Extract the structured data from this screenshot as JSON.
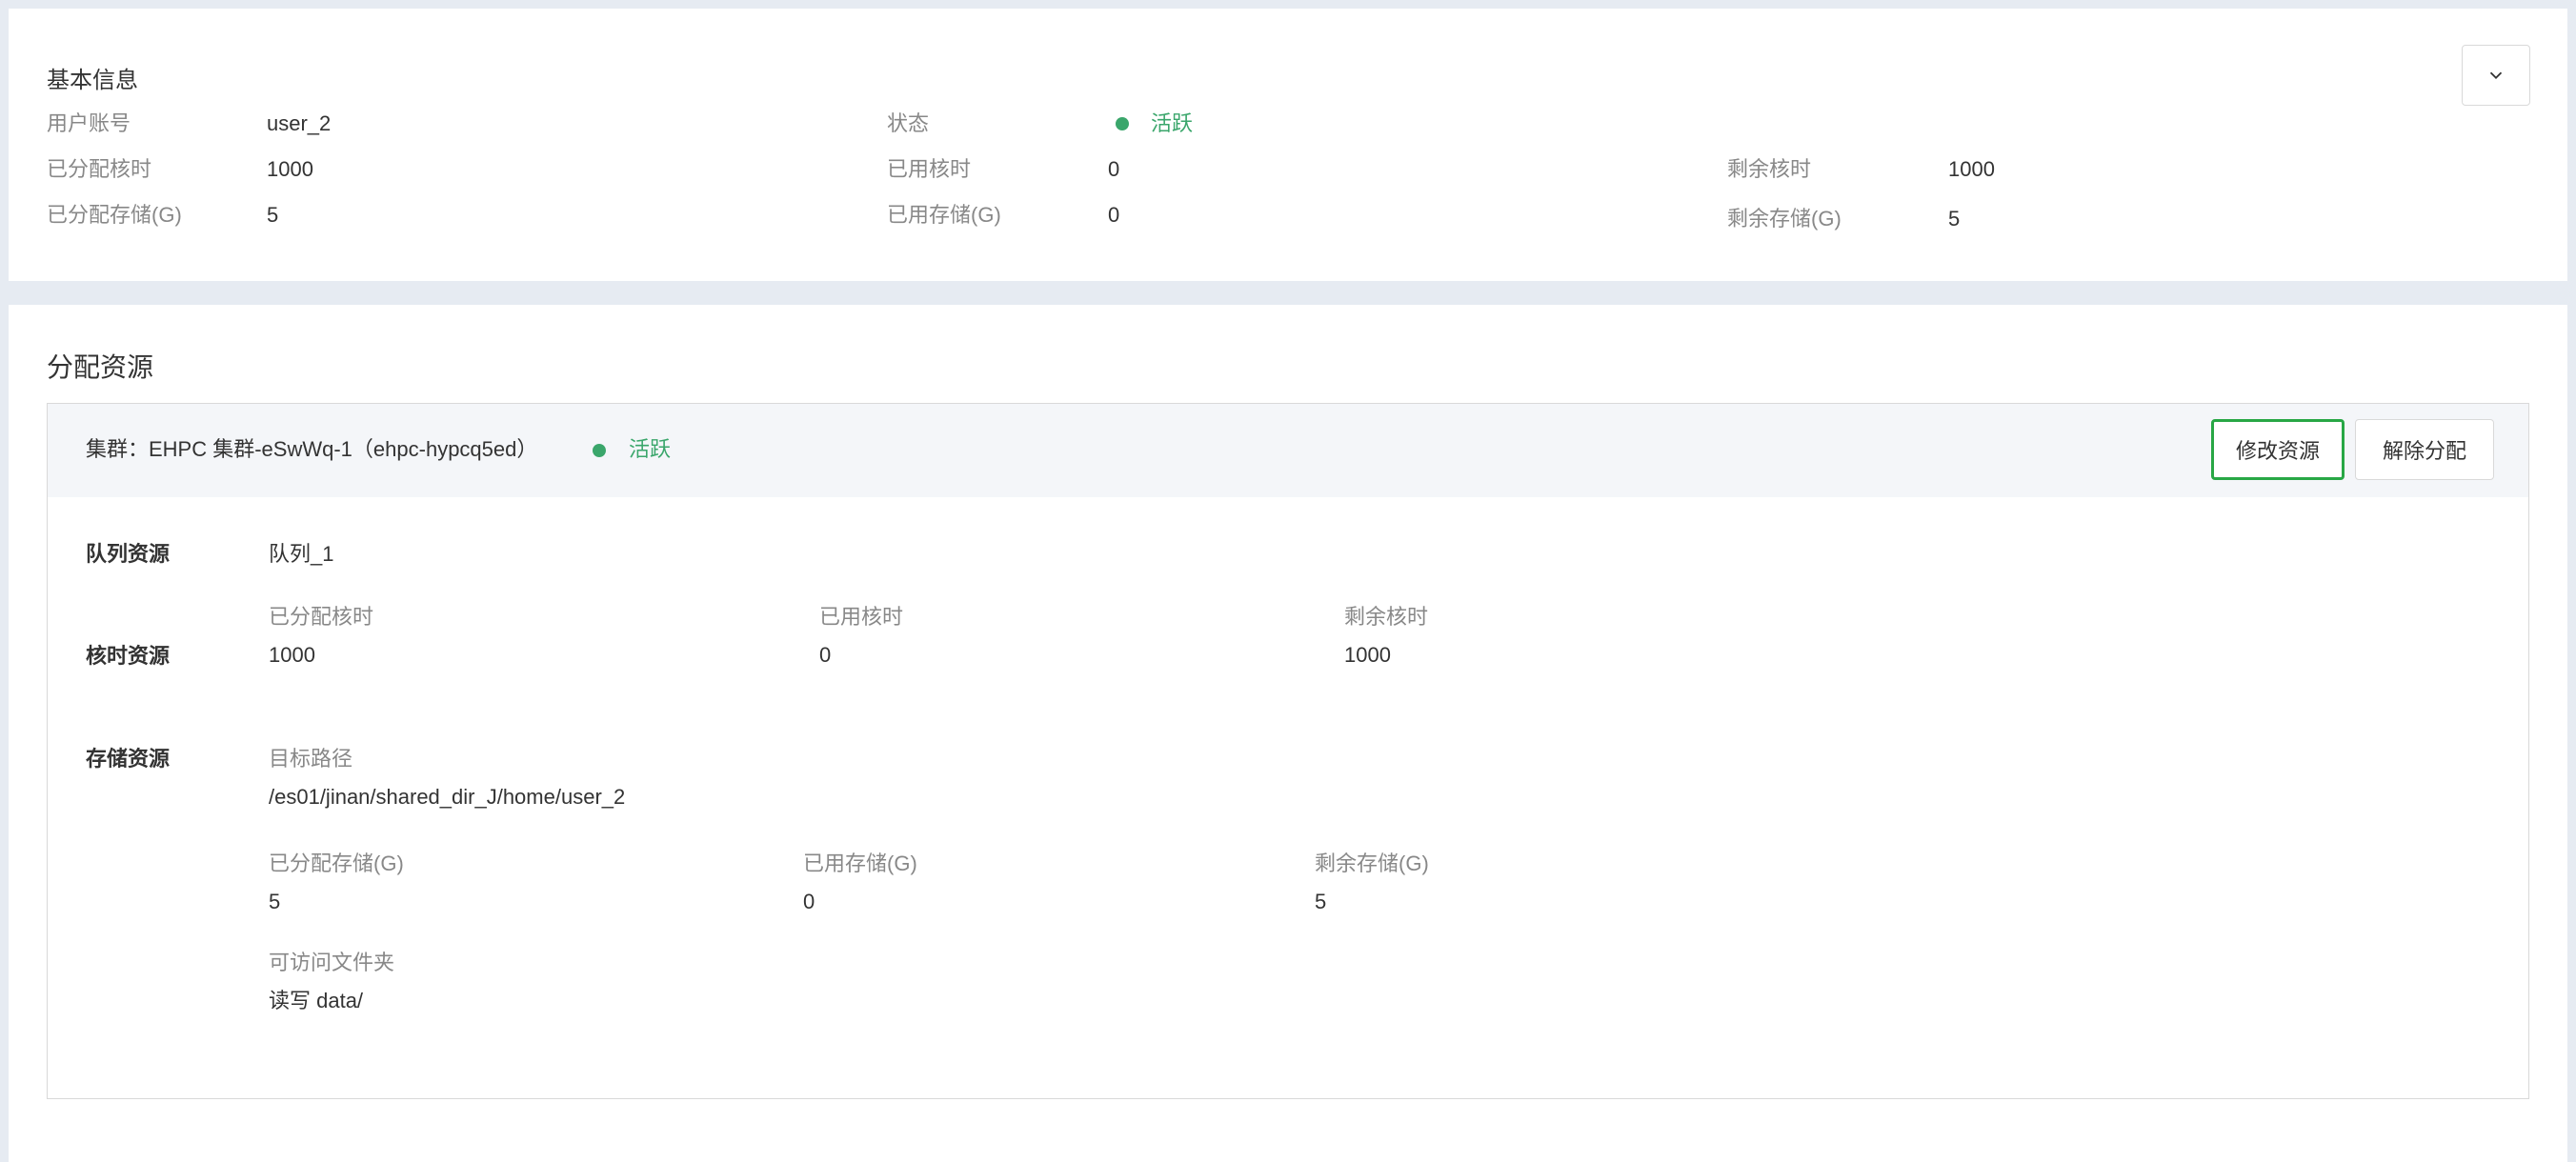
{
  "basic_info": {
    "title": "基本信息",
    "user_account_label": "用户账号",
    "user_account_value": "user_2",
    "status_label": "状态",
    "status_value": "活跃",
    "allocated_core_hours_label": "已分配核时",
    "allocated_core_hours_value": "1000",
    "used_core_hours_label": "已用核时",
    "used_core_hours_value": "0",
    "remaining_core_hours_label": "剩余核时",
    "remaining_core_hours_value": "1000",
    "allocated_storage_label": "已分配存储(G)",
    "allocated_storage_value": "5",
    "used_storage_label": "已用存储(G)",
    "used_storage_value": "0",
    "remaining_storage_label": "剩余存储(G)",
    "remaining_storage_value": "5"
  },
  "allocation": {
    "title": "分配资源",
    "cluster": {
      "title": "集群：EHPC 集群-eSwWq-1（ehpc-hypcq5ed）",
      "status": "活跃",
      "modify_button": "修改资源",
      "release_button": "解除分配"
    },
    "queue": {
      "label": "队列资源",
      "value": "队列_1"
    },
    "core_hours": {
      "label": "核时资源",
      "allocated_label": "已分配核时",
      "allocated_value": "1000",
      "used_label": "已用核时",
      "used_value": "0",
      "remaining_label": "剩余核时",
      "remaining_value": "1000"
    },
    "storage": {
      "label": "存储资源",
      "path_label": "目标路径",
      "path_value": "/es01/jinan/shared_dir_J/home/user_2",
      "allocated_label": "已分配存储(G)",
      "allocated_value": "5",
      "used_label": "已用存储(G)",
      "used_value": "0",
      "remaining_label": "剩余存储(G)",
      "remaining_value": "5",
      "folders_label": "可访问文件夹",
      "folders_value": "读写 data/"
    }
  },
  "colors": {
    "active_status": "#3aa66b",
    "highlight_border": "#28a745",
    "page_background": "#e6ebf2"
  },
  "icons": {
    "collapse": "chevron-down-icon",
    "status": "status-dot-icon"
  }
}
